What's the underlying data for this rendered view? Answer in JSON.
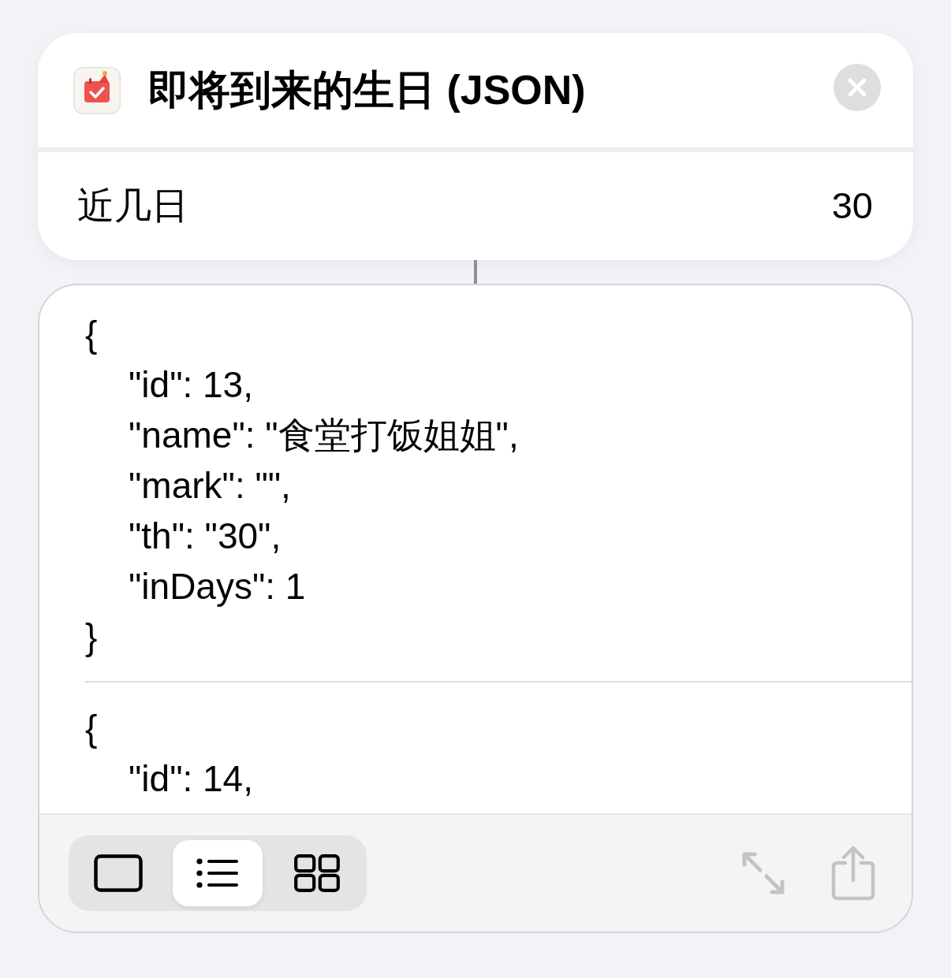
{
  "window": {
    "title": "即将到来的生日 (JSON)"
  },
  "parameter": {
    "label": "近几日",
    "value": "30"
  },
  "records": [
    {
      "open": "{",
      "fields": [
        "\"id\": 13,",
        "\"name\": \"食堂打饭姐姐\",",
        "\"mark\": \"\",",
        "\"th\": \"30\",",
        "\"inDays\": 1"
      ],
      "close": "}"
    },
    {
      "open": "{",
      "fields": [
        "\"id\": 14,"
      ]
    }
  ],
  "view_modes": [
    {
      "kind": "single",
      "selected": false
    },
    {
      "kind": "list",
      "selected": true
    },
    {
      "kind": "grid",
      "selected": false
    }
  ]
}
